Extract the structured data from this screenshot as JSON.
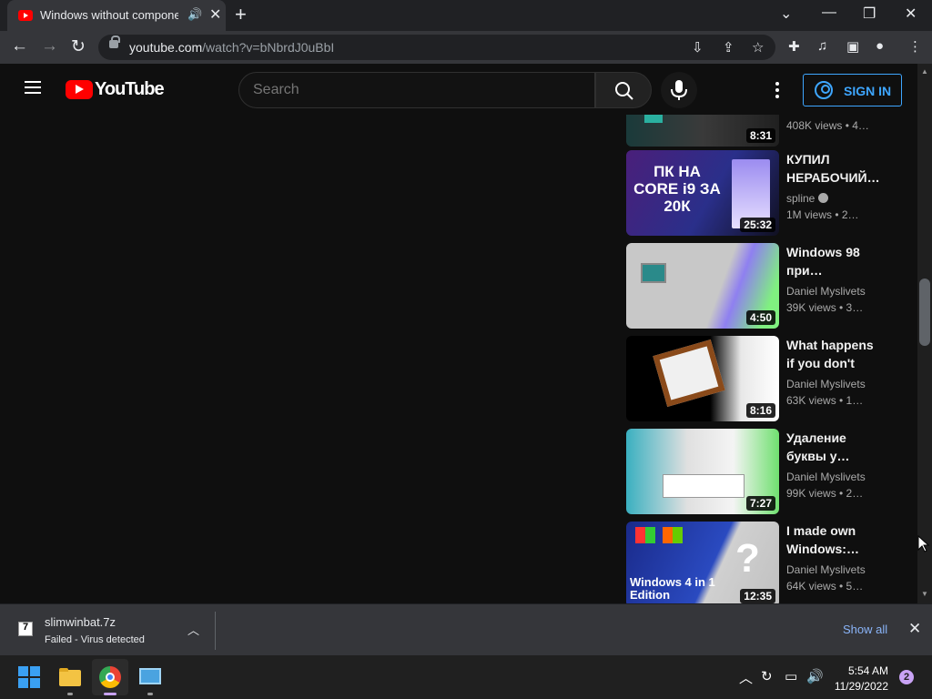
{
  "browser": {
    "tab_title": "Windows without components",
    "url_host": "youtube.com",
    "url_path": "/watch?v=bNbrdJ0uBbI"
  },
  "youtube": {
    "logo_text": "YouTube",
    "search_placeholder": "Search",
    "signin_label": "SIGN IN"
  },
  "videos": [
    {
      "title": "",
      "channel": "",
      "meta": "408K views  •  4…",
      "duration": "8:31"
    },
    {
      "title": "КУПИЛ НЕРАБОЧИЙ…",
      "channel": "spline",
      "verified": true,
      "meta": "1M views  •  2…",
      "duration": "25:32",
      "thumb_text": "ПК НА CORE i9 ЗА 20К"
    },
    {
      "title": "Windows 98 при…",
      "channel": "Daniel Myslivets",
      "meta": "39K views  •  3…",
      "duration": "4:50"
    },
    {
      "title": "What happens if you don't ful…",
      "channel": "Daniel Myslivets",
      "meta": "63K views  •  1…",
      "duration": "8:16"
    },
    {
      "title": "Удаление буквы у…",
      "channel": "Daniel Myslivets",
      "meta": "99K views  •  2…",
      "duration": "7:27"
    },
    {
      "title": "I made own Windows:…",
      "channel": "Daniel Myslivets",
      "meta": "64K views  •  5…",
      "duration": "12:35",
      "thumb_text": "Windows 4 in 1 Edition"
    }
  ],
  "download": {
    "file_name": "slimwinbat.7z",
    "status": "Failed - Virus detected",
    "show_all": "Show all"
  },
  "taskbar": {
    "time": "5:54 AM",
    "date": "11/29/2022",
    "notification_count": "2"
  },
  "colors": {
    "yt_red": "#ff0000",
    "link_blue": "#3ea6ff",
    "background": "#0f0f0f"
  }
}
